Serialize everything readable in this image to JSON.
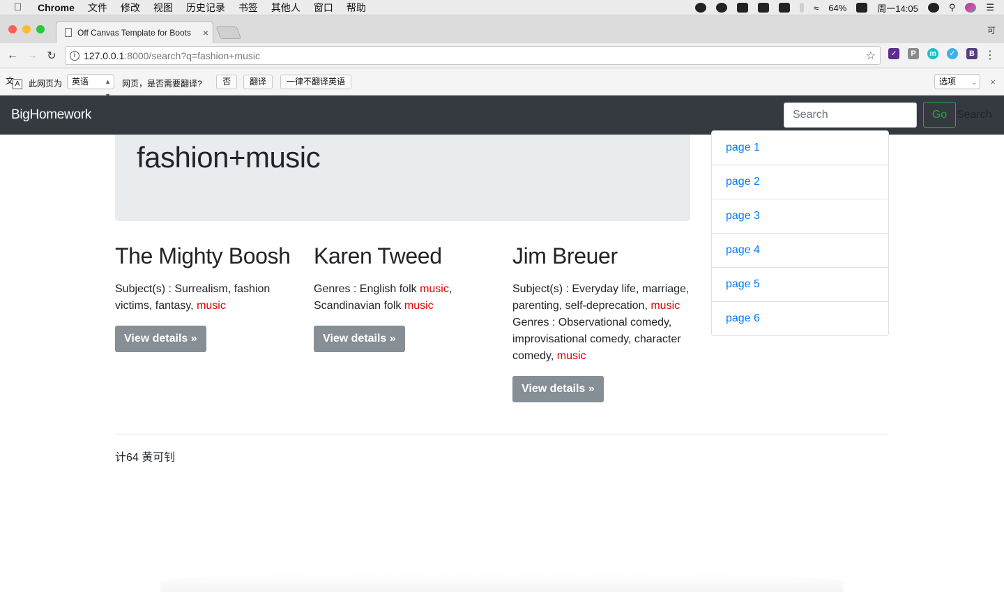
{
  "menubar": {
    "app": "Chrome",
    "items": [
      "文件",
      "修改",
      "视图",
      "历史记录",
      "书签",
      "其他人",
      "窗口",
      "帮助"
    ],
    "battery": "64%",
    "clock": "周一14:05"
  },
  "browser": {
    "tab_title": "Off Canvas Template for Boots",
    "corner_char": "可",
    "url_host": "127.0.0.1",
    "url_path": ":8000/search?q=fashion+music"
  },
  "translate": {
    "page_is": "此网页为",
    "language": "英语",
    "question": "网页，是否需要翻译?",
    "no": "否",
    "translate": "翻译",
    "never": "一律不翻译英语",
    "options": "选项"
  },
  "navbar": {
    "brand": "BigHomework",
    "search_placeholder": "Search",
    "go": "Go",
    "search_label": "Search"
  },
  "jumbotron": {
    "query": "fashion+music"
  },
  "results": [
    {
      "title": "The Mighty Boosh",
      "subject_prefix": "Subject(s) : Surrealism, fashion victims, fantasy, ",
      "subject_hl": "music",
      "button": "View details »"
    },
    {
      "title": "Karen Tweed",
      "genres_prefix": "Genres : English folk ",
      "genres_hl1": "music",
      "genres_mid": ", Scandinavian folk ",
      "genres_hl2": "music",
      "button": "View details »"
    },
    {
      "title": "Jim Breuer",
      "subject_prefix": "Subject(s) : Everyday life, marriage, parenting, self-deprecation, ",
      "subject_hl": "music",
      "genres_prefix": "Genres : Observational comedy, improvisational comedy, character comedy, ",
      "genres_hl": "music",
      "button": "View details »"
    }
  ],
  "pages": [
    "page 1",
    "page 2",
    "page 3",
    "page 4",
    "page 5",
    "page 6"
  ],
  "footer": "计64 黄可钊",
  "colors": {
    "navbar_bg": "#343a40",
    "link": "#007bff",
    "highlight": "#e00000",
    "go_green": "#28a745",
    "button_grey": "#868e96"
  }
}
